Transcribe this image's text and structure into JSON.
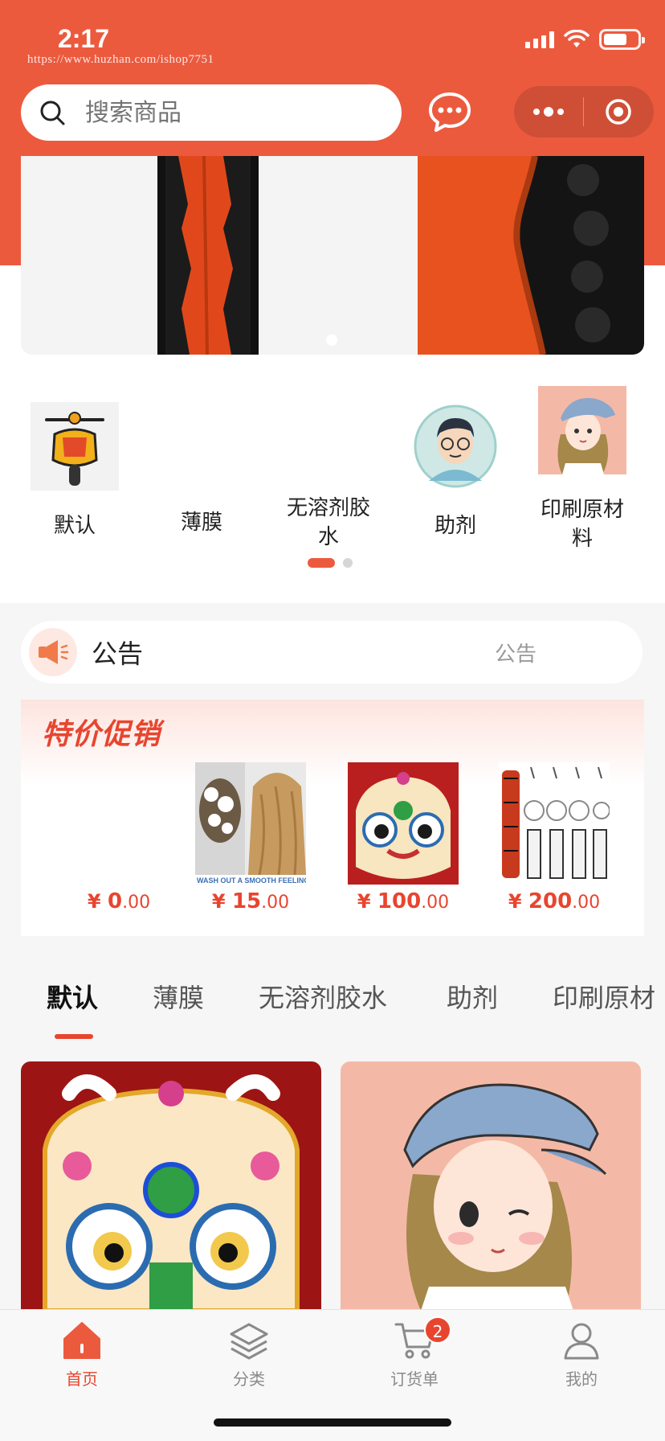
{
  "status_bar": {
    "time": "2:17",
    "watermark": "https://www.huzhan.com/ishop7751",
    "battery_level": 0.7
  },
  "header": {
    "search_placeholder": "搜索商品",
    "icons": [
      "search-icon",
      "chat-icon",
      "more-icon",
      "close-target-icon"
    ]
  },
  "banner": {
    "page_count": 1,
    "active_index": 0
  },
  "categories": {
    "items": [
      {
        "label": "默认",
        "icon": "scooter-icon"
      },
      {
        "label": "薄膜",
        "icon": ""
      },
      {
        "label": "无溶剂胶水",
        "icon": ""
      },
      {
        "label": "助剂",
        "icon": "avatar-man-icon"
      },
      {
        "label": "印刷原材料",
        "icon": "avatar-girl-icon"
      }
    ],
    "page_count": 2,
    "active_page": 0
  },
  "notice": {
    "title": "公告",
    "text": "公告"
  },
  "promotion": {
    "title": "特价促销",
    "items": [
      {
        "currency": "¥",
        "int": "0",
        "dec": ".00"
      },
      {
        "currency": "¥",
        "int": "15",
        "dec": ".00",
        "caption": "WASH OUT A SMOOTH FEELING"
      },
      {
        "currency": "¥",
        "int": "100",
        "dec": ".00"
      },
      {
        "currency": "¥",
        "int": "200",
        "dec": ".00"
      }
    ]
  },
  "tabs": [
    "默认",
    "薄膜",
    "无溶剂胶水",
    "助剂",
    "印刷原材"
  ],
  "bottom_nav": {
    "items": [
      {
        "label": "首页",
        "icon": "home-icon",
        "active": true
      },
      {
        "label": "分类",
        "icon": "layers-icon",
        "active": false
      },
      {
        "label": "订货单",
        "icon": "cart-icon",
        "active": false,
        "badge": "2"
      },
      {
        "label": "我的",
        "icon": "user-icon",
        "active": false
      }
    ]
  },
  "colors": {
    "brand": "#ec5a3e",
    "price": "#e8452f",
    "background": "#f6f6f6"
  }
}
